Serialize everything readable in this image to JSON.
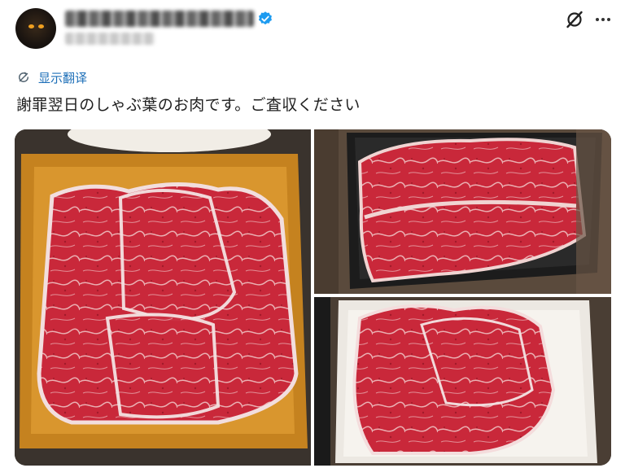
{
  "header": {
    "display_name_blurred": "",
    "handle_blurred": "",
    "verified_badge_color": "#1d9bf0",
    "icons": [
      "grok-icon",
      "more-options-icon"
    ]
  },
  "translate": {
    "label": "显示翻译",
    "icon": "translate-icon",
    "color": "#1d6fb8"
  },
  "post": {
    "text": "謝罪翌日のしゃぶ葉のお肉です。ご査収ください"
  },
  "media": {
    "photos": [
      {
        "subject": "sliced red meat on orange square tray"
      },
      {
        "subject": "sliced red meat in black tray"
      },
      {
        "subject": "sliced red meat on white tray"
      }
    ]
  }
}
